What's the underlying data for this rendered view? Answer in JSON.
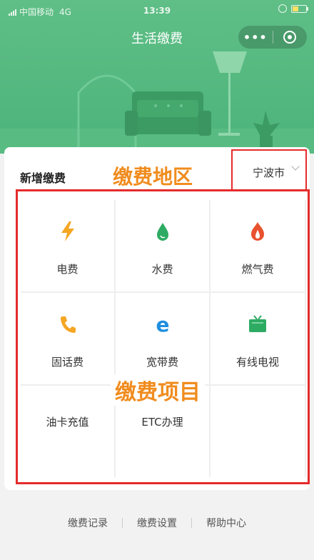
{
  "status_bar": {
    "carrier": "中国移动",
    "network": "4G",
    "time": "13:39"
  },
  "nav": {
    "title": "生活缴费",
    "more": "•••"
  },
  "payment": {
    "title": "新增缴费",
    "region_annotation": "缴费地区",
    "city": "宁波市",
    "items_annotation": "缴费项目",
    "items": [
      {
        "label": "电费",
        "icon": "lightning-icon"
      },
      {
        "label": "水费",
        "icon": "water-drop-icon"
      },
      {
        "label": "燃气费",
        "icon": "flame-icon"
      },
      {
        "label": "固话费",
        "icon": "phone-icon"
      },
      {
        "label": "宽带费",
        "icon": "broadband-e-icon"
      },
      {
        "label": "有线电视",
        "icon": "tv-icon"
      },
      {
        "label": "油卡充值",
        "icon": "fuel-card-icon"
      },
      {
        "label": "ETC办理",
        "icon": "etc-icon"
      }
    ]
  },
  "footer": {
    "records": "缴费记录",
    "settings": "缴费设置",
    "help": "帮助中心"
  },
  "colors": {
    "header_green": "#52b87e",
    "annotation_orange": "#f08c1e",
    "highlight_red": "#e52b2b",
    "icon_orange": "#f5a623",
    "icon_green": "#2eab63",
    "icon_red": "#e8522e",
    "icon_blue": "#1f8fe0"
  }
}
